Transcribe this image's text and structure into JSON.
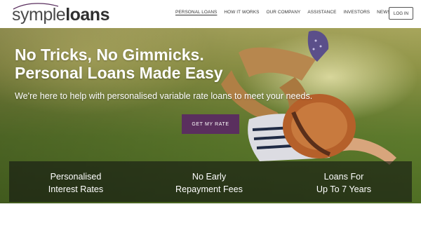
{
  "logo": {
    "light": "symple",
    "bold": "loans"
  },
  "nav": {
    "items": [
      {
        "label": "Personal Loans",
        "active": true
      },
      {
        "label": "How It Works",
        "active": false
      },
      {
        "label": "Our Company",
        "active": false
      },
      {
        "label": "Assistance",
        "active": false
      },
      {
        "label": "Investors",
        "active": false
      },
      {
        "label": "News Room",
        "active": false
      }
    ],
    "login_label": "Log In"
  },
  "hero": {
    "title_line1": "No Tricks, No Gimmicks.",
    "title_line2": "Personal Loans Made Easy",
    "subtitle": "We're here to help with personalised variable rate loans to meet your needs.",
    "cta_label": "Get My Rate"
  },
  "features": [
    {
      "line1": "Personalised",
      "line2": "Interest Rates"
    },
    {
      "line1": "No Early",
      "line2": "Repayment Fees"
    },
    {
      "line1": "Loans For",
      "line2": "Up To 7 Years"
    }
  ],
  "colors": {
    "brand_purple": "#5a2f5e",
    "text_dark": "#333333",
    "feature_overlay": "#141612"
  }
}
